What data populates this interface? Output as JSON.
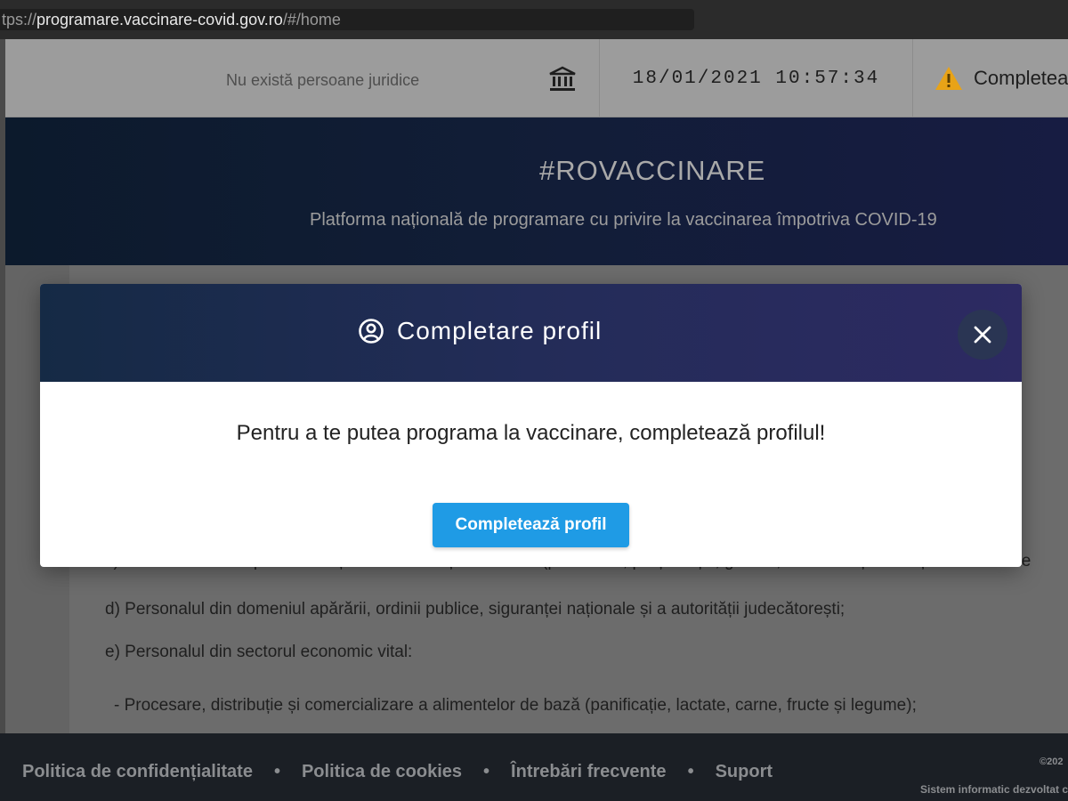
{
  "browser": {
    "url_prefix": "tps://",
    "url_host": "programare.vaccinare-covid.gov.ro",
    "url_slash": "/",
    "url_hash": "#/home"
  },
  "topbar": {
    "legal_entities": "Nu există persoane juridice",
    "datetime": "18/01/2021 10:57:34",
    "warning_label": "Completeaz"
  },
  "hero": {
    "title": "#ROVACCINARE",
    "subtitle": "Platforma națională de programare cu privire la vaccinarea împotriva COVID-19"
  },
  "content": {
    "paragraphs": [
      "c) Personalul cheie pentru funcționarea instituțiilor statului (parlament, președinție, guvern, ministere și instituții subordonate",
      "d) Personalul din domeniul apărării, ordinii publice, siguranței naționale și a autorității judecătorești;",
      "e) Personalul din sectorul economic vital:",
      "- Procesare, distribuție și comercializare a alimentelor de bază (panificație, lactate, carne, fructe și legume);"
    ]
  },
  "modal": {
    "title": "Completare profil",
    "message": "Pentru a te putea programa la vaccinare, completează profilul!",
    "button_label": "Completează profil"
  },
  "footer": {
    "links": [
      "Politica de confidențialitate",
      "Politica de cookies",
      "Întrebări frecvente",
      "Suport"
    ],
    "separator": "•",
    "copyright": "©202",
    "system_text": "Sistem informatic dezvoltat c"
  },
  "icons": {
    "bank": "bank-icon",
    "warning": "warning-icon",
    "user": "user-circle-icon",
    "close": "close-icon"
  },
  "colors": {
    "primary_button": "#1f9be5",
    "warning": "#e8a317",
    "modal_header_start": "#152a45",
    "modal_header_end": "#2d2a62"
  }
}
